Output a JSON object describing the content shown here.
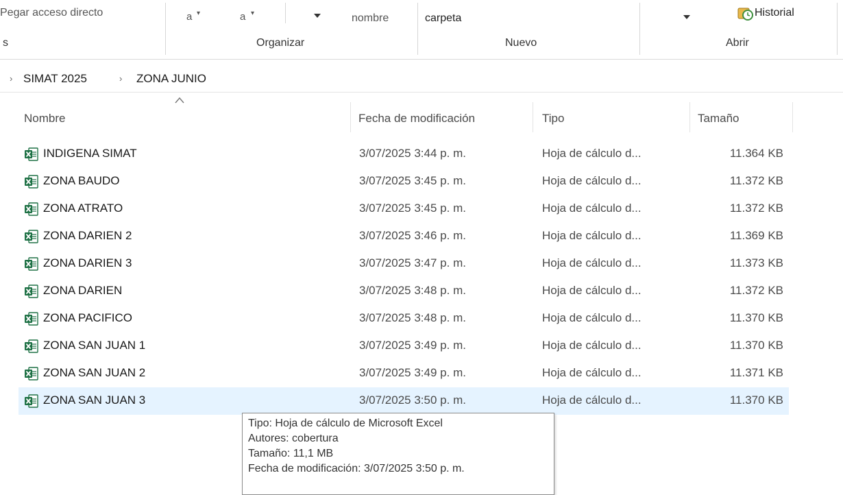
{
  "ribbon": {
    "paste_shortcut": "Pegar acceso directo",
    "move_to": "a",
    "copy_to": "a",
    "new_folder_line1": "nombre",
    "new_folder_line2": "carpeta",
    "history": "Historial",
    "group_clipboard_tail": "s",
    "group_organize": "Organizar",
    "group_new": "Nuevo",
    "group_open": "Abrir"
  },
  "breadcrumb": {
    "items": [
      "SIMAT 2025",
      "ZONA JUNIO"
    ]
  },
  "columns": {
    "name": "Nombre",
    "modified": "Fecha de modificación",
    "type": "Tipo",
    "size": "Tamaño"
  },
  "files": [
    {
      "name": "INDIGENA SIMAT",
      "modified": "3/07/2025 3:44 p. m.",
      "type": "Hoja de cálculo d...",
      "size": "11.364 KB"
    },
    {
      "name": "ZONA  BAUDO",
      "modified": "3/07/2025 3:45 p. m.",
      "type": "Hoja de cálculo d...",
      "size": "11.372 KB"
    },
    {
      "name": "ZONA ATRATO",
      "modified": "3/07/2025 3:45 p. m.",
      "type": "Hoja de cálculo d...",
      "size": "11.372 KB"
    },
    {
      "name": "ZONA DARIEN 2",
      "modified": "3/07/2025 3:46 p. m.",
      "type": "Hoja de cálculo d...",
      "size": "11.369 KB"
    },
    {
      "name": "ZONA DARIEN 3",
      "modified": "3/07/2025 3:47 p. m.",
      "type": "Hoja de cálculo d...",
      "size": "11.373 KB"
    },
    {
      "name": "ZONA DARIEN",
      "modified": "3/07/2025 3:48 p. m.",
      "type": "Hoja de cálculo d...",
      "size": "11.372 KB"
    },
    {
      "name": "ZONA PACIFICO",
      "modified": "3/07/2025 3:48 p. m.",
      "type": "Hoja de cálculo d...",
      "size": "11.370 KB"
    },
    {
      "name": "ZONA SAN JUAN 1",
      "modified": "3/07/2025 3:49 p. m.",
      "type": "Hoja de cálculo d...",
      "size": "11.370 KB"
    },
    {
      "name": "ZONA SAN JUAN 2",
      "modified": "3/07/2025 3:49 p. m.",
      "type": "Hoja de cálculo d...",
      "size": "11.371 KB"
    },
    {
      "name": "ZONA SAN JUAN 3",
      "modified": "3/07/2025 3:50 p. m.",
      "type": "Hoja de cálculo d...",
      "size": "11.370 KB"
    }
  ],
  "tooltip": {
    "type": "Tipo: Hoja de cálculo de Microsoft Excel",
    "authors": "Autores: cobertura",
    "size": "Tamaño: 11,1 MB",
    "modified": "Fecha de modificación: 3/07/2025 3:50 p. m."
  },
  "colors": {
    "excel_green": "#1e7145",
    "selection": "#e5f3ff"
  },
  "icons": {
    "file_icon": "excel-file-icon",
    "history_icon": "history-icon"
  }
}
